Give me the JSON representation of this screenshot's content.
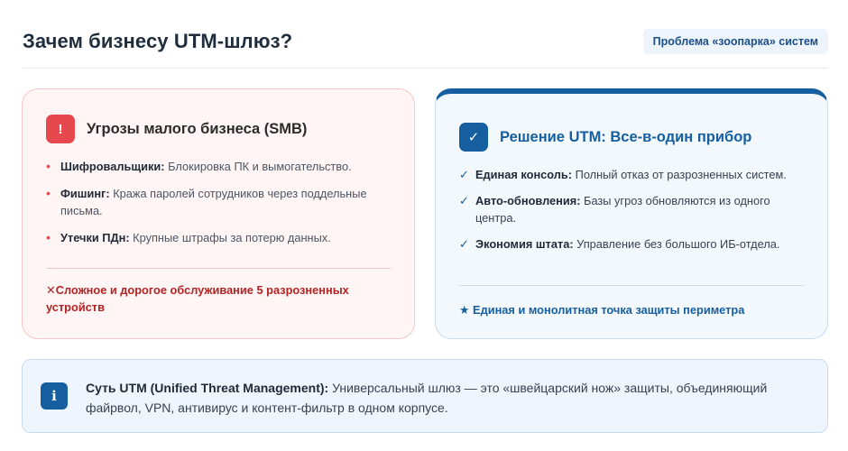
{
  "header": {
    "title": "Зачем бизнесу UTM-шлюз?",
    "tag": "Проблема «зоопарка» систем"
  },
  "threats": {
    "icon": "!",
    "title": "Угрозы малого бизнеса (SMB)",
    "items": [
      {
        "term": "Шифровальщики:",
        "text": " Блокировка ПК и вымогательство."
      },
      {
        "term": "Фишинг:",
        "text": " Кража паролей сотрудников через поддельные письма."
      },
      {
        "term": "Утечки ПДн:",
        "text": " Крупные штрафы за потерю данных."
      }
    ],
    "footer_icon": "✕",
    "footer": "Сложное и дорогое обслуживание 5 разрозненных устройств"
  },
  "solution": {
    "icon": "✓",
    "title": "Решение UTM: Все-в-один прибор",
    "items": [
      {
        "term": "Единая консоль:",
        "text": " Полный отказ от разрозненных систем."
      },
      {
        "term": "Авто-обновления:",
        "text": " Базы угроз обновляются из одного центра."
      },
      {
        "term": "Экономия штата:",
        "text": " Управление без большого ИБ-отдела."
      }
    ],
    "footer_icon": "★",
    "footer": "Единая и монолитная точка защиты периметра"
  },
  "info": {
    "icon": "i",
    "term": "Суть UTM (Unified Threat Management):",
    "text": " Универсальный шлюз — это «швейцарский нож» защиты, объединяющий файрвол, VPN, антивирус и контент-фильтр в одном корпусе."
  },
  "colors": {
    "accent_blue": "#155fa0",
    "accent_red": "#e5484d",
    "warning_text": "#b42323"
  }
}
